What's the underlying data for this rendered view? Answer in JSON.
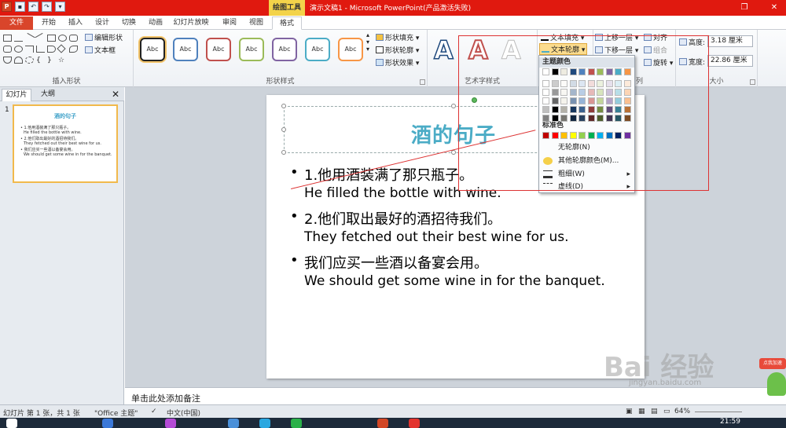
{
  "titlebar": {
    "context_tab_title": "绘图工具",
    "window_title": "演示文稿1 - Microsoft PowerPoint(产品激活失败)"
  },
  "tabs": {
    "file": "文件",
    "items": [
      "开始",
      "插入",
      "设计",
      "切换",
      "动画",
      "幻灯片放映",
      "审阅",
      "视图",
      "格式"
    ]
  },
  "ribbon": {
    "insert_shapes": {
      "edit_shape": "编辑形状",
      "text_box": "文本框",
      "label": "插入形状"
    },
    "shape_styles": {
      "abc": [
        "Abc",
        "Abc",
        "Abc",
        "Abc",
        "Abc",
        "Abc",
        "Abc"
      ],
      "fill": "形状填充",
      "outline": "形状轮廓",
      "effects": "形状效果",
      "label": "形状样式"
    },
    "wordart": {
      "sample": "A",
      "text_fill": "文本填充",
      "text_outline": "文本轮廓",
      "label": "艺术字样式"
    },
    "arrange": {
      "bring_forward": "上移一层",
      "send_backward": "下移一层",
      "align": "对齐",
      "group": "组合",
      "rotate": "旋转",
      "label_fragment": "列"
    },
    "size": {
      "height_label": "高度:",
      "height_value": "3.18 厘米",
      "width_label": "宽度:",
      "width_value": "22.86 厘米",
      "label": "大小"
    }
  },
  "left_pane": {
    "tab_slides": "幻灯片",
    "tab_outline": "大纲",
    "slide_number": "1",
    "thumb_title": "酒的句子",
    "thumb_lines": [
      "• 1.他用酒装满了那只瓶子。",
      "He filled the bottle with wine.",
      "• 2.他们取出最好的酒招待我们。",
      "They fetched out their best wine for us.",
      "• 我们应买一些酒以备宴会用。",
      "We should get some wine in for the banquet."
    ]
  },
  "slide": {
    "title": "酒的句子",
    "bullets": [
      {
        "main": "1.他用酒装满了那只瓶子。",
        "sub": "He filled the bottle with wine."
      },
      {
        "main": "2.他们取出最好的酒招待我们。",
        "sub": "They fetched out their best wine for us."
      },
      {
        "main": "我们应买一些酒以备宴会用。",
        "sub": "We should get some wine in for the banquet."
      }
    ]
  },
  "dropdown": {
    "theme_colors_label": "主题颜色",
    "standard_colors_label": "标准色",
    "no_outline": "无轮廓(N)",
    "more_colors": "其他轮廓颜色(M)...",
    "weight": "粗细(W)",
    "dashes": "虚线(D)",
    "theme_top_row": [
      "#ffffff",
      "#000000",
      "#eeece1",
      "#1f497d",
      "#4f81bd",
      "#c0504d",
      "#9bbb59",
      "#8064a2",
      "#4bacc6",
      "#f79646"
    ],
    "standard_row": [
      "#c00000",
      "#ff0000",
      "#ffc000",
      "#ffff00",
      "#92d050",
      "#00b050",
      "#00b0f0",
      "#0070c0",
      "#002060",
      "#7030a0"
    ]
  },
  "notes": {
    "placeholder": "单击此处添加备注"
  },
  "status": {
    "slide_info": "幻灯片 第 1 张，共 1 张",
    "theme": "\"Office 主题\"",
    "language": "中文(中国)",
    "zoom": "64%"
  },
  "taskbar": {
    "clock": "21:59"
  },
  "watermark": {
    "brand": "Bai 经验",
    "url": "jingyan.baidu.com",
    "badge": "点我加速"
  },
  "colors": {
    "titlebar": "#e0190f",
    "context_tab": "#f3d34a",
    "file_tab": "#d9452b",
    "slide_title": "#4bacc6",
    "annotation": "#dd3333"
  }
}
